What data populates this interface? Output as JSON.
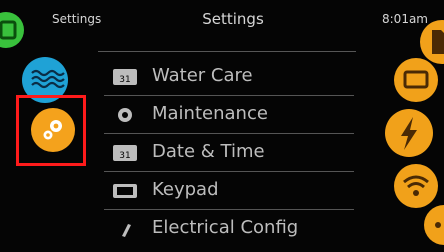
{
  "header": {
    "left_label": "Settings",
    "title": "Settings",
    "time": "8:01am"
  },
  "menu": {
    "items": [
      {
        "label": "Water Care",
        "icon": "calendar-31-icon"
      },
      {
        "label": "Maintenance",
        "icon": "wrench-gear-icon"
      },
      {
        "label": "Date & Time",
        "icon": "calendar-time-icon"
      },
      {
        "label": "Keypad",
        "icon": "keypad-icon"
      },
      {
        "label": "Electrical Config",
        "icon": "pencil-icon"
      }
    ]
  },
  "left_nav": [
    {
      "name": "home-icon",
      "color": "#39c13c"
    },
    {
      "name": "water-waves-icon",
      "color": "#1fa2d6"
    },
    {
      "name": "settings-gears-icon",
      "color": "#f4a21c",
      "selected": true
    }
  ],
  "right_nav": [
    {
      "name": "sd-card-icon"
    },
    {
      "name": "screen-icon"
    },
    {
      "name": "lightning-icon"
    },
    {
      "name": "wifi-icon"
    },
    {
      "name": "more-dots-icon"
    }
  ],
  "colors": {
    "background": "#050505",
    "text": "#bdbdbd",
    "accent": "#f4a21c",
    "selection_border": "#ff1b1b"
  }
}
